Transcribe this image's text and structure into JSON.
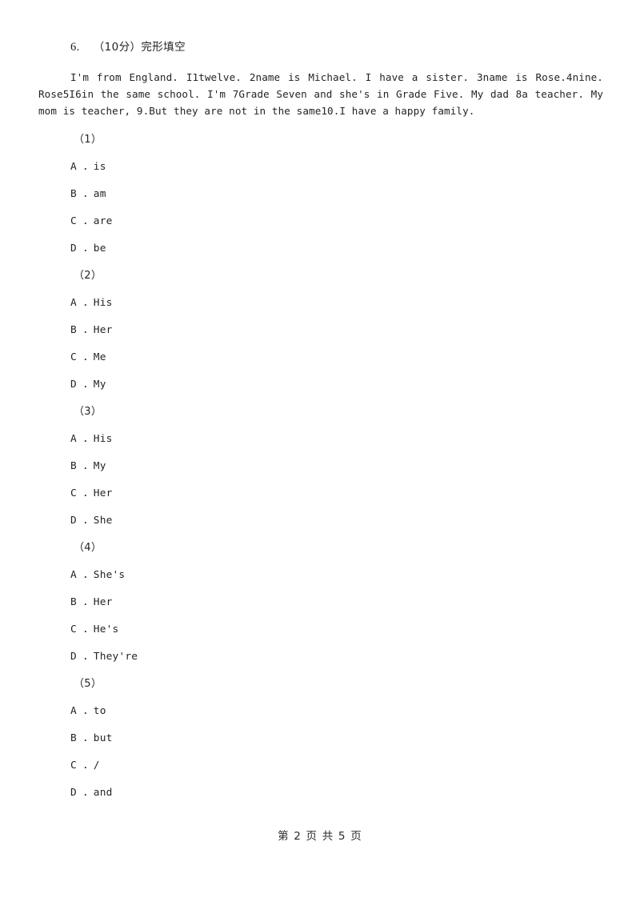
{
  "document": {
    "question_header": {
      "number": "6.",
      "score": "（10分）",
      "title": "完形填空"
    },
    "passage": {
      "indent_text": "    ",
      "line1": "I'm from England. I1twelve. 2name is Michael. I have a sister. 3name is Rose.4nine. Rose5I6in",
      "line2": "the same school. I'm 7Grade Seven and she's in Grade Five. My dad 8a teacher. My mom is teacher,",
      "line3": "9.But they are not in the same10.I have a happy family.",
      "full_text": "I'm from England. I1twelve. 2name is Michael. I have a sister. 3name is Rose.4nine. Rose5I6in the same school. I'm 7Grade Seven and she's in Grade Five. My dad 8a teacher. My mom is teacher, 9.But they are not in the same10.I have a happy family."
    },
    "questions": [
      {
        "label": "（1）",
        "options": [
          "A ．is",
          "B ．am",
          "C ．are",
          "D ．be"
        ]
      },
      {
        "label": "（2）",
        "options": [
          "A ．His",
          "B ．Her",
          "C ．Me",
          "D ．My"
        ]
      },
      {
        "label": "（3）",
        "options": [
          "A ．His",
          "B ．My",
          "C ．Her",
          "D ．She"
        ]
      },
      {
        "label": "（4）",
        "options": [
          "A ．She's",
          "B ．Her",
          "C ．He's",
          "D ．They're"
        ]
      },
      {
        "label": "（5）",
        "options": [
          "A ．to",
          "B ．but",
          "C ．/",
          "D ．and"
        ]
      }
    ],
    "footer": {
      "text": "第 2 页 共 5 页",
      "current_page": "2",
      "total_pages": "5"
    },
    "colors": {
      "page_background": "#ffffff",
      "text": "#242424"
    }
  }
}
